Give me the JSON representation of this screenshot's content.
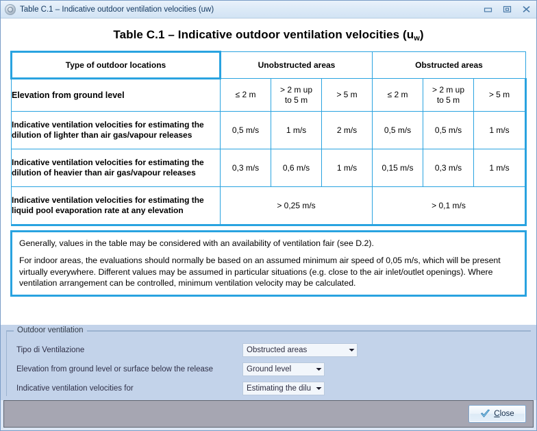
{
  "window": {
    "title": "Table C.1 – Indicative outdoor ventilation velocities (uw)",
    "icon": "globe-icon",
    "buttons": {
      "minimize": "minimize-icon",
      "restore": "restore-icon",
      "close": "close-icon"
    }
  },
  "document": {
    "title_main": "Table C.1 – Indicative outdoor ventilation velocities (u",
    "title_sub": "w",
    "title_tail": ")"
  },
  "table": {
    "headers": {
      "col0": "Type of outdoor locations",
      "unobstructed": "Unobstructed areas",
      "obstructed": "Obstructed areas"
    },
    "elevation": {
      "label": "Elevation from ground level",
      "cells": [
        "≤ 2 m",
        "> 2 m up\nto 5 m",
        "> 5 m",
        "≤ 2 m",
        "> 2 m up\nto 5 m",
        "> 5 m"
      ]
    },
    "rows": [
      {
        "label": "Indicative ventilation velocities for estimating the dilution of lighter than air gas/vapour releases",
        "cells": [
          "0,5 m/s",
          "1 m/s",
          "2 m/s",
          "0,5 m/s",
          "0,5 m/s",
          "1 m/s"
        ]
      },
      {
        "label": "Indicative ventilation velocities for estimating the dilution of heavier than air gas/vapour releases",
        "cells": [
          "0,3 m/s",
          "0,6 m/s",
          "1 m/s",
          "0,15 m/s",
          "0,3 m/s",
          "1 m/s"
        ]
      }
    ],
    "pool_row": {
      "label": "Indicative ventilation velocities for estimating the liquid pool evaporation rate at any elevation",
      "unobstructed_value": "> 0,25 m/s",
      "obstructed_value": "> 0,1 m/s"
    }
  },
  "notes": {
    "p1": "Generally, values in the table may be considered with an availability of ventilation fair (see D.2).",
    "p2": "For indoor areas, the evaluations should normally be based on an assumed minimum air speed of 0,05 m/s, which will be present virtually everywhere. Different values may be assumed in particular situations (e.g. close to the air inlet/outlet openings). Where ventilation arrangement can be controlled, minimum ventilation velocity may be calculated."
  },
  "form": {
    "group_label": "Outdoor ventilation",
    "fields": [
      {
        "label": "Tipo di Ventilazione",
        "value": "Obstructed areas"
      },
      {
        "label": "Elevation from ground level or surface below the release",
        "value": "Ground level"
      },
      {
        "label": "Indicative ventilation velocities for",
        "value": "Estimating the dilu"
      }
    ]
  },
  "footer": {
    "close_accel": "C",
    "close_rest": "lose",
    "close_icon": "checkmark-icon"
  },
  "colors": {
    "table_border": "#29a3e0",
    "panel_bg": "#c3d3ea",
    "footer_bg": "#a6a6b2",
    "title_text": "#12365e"
  }
}
